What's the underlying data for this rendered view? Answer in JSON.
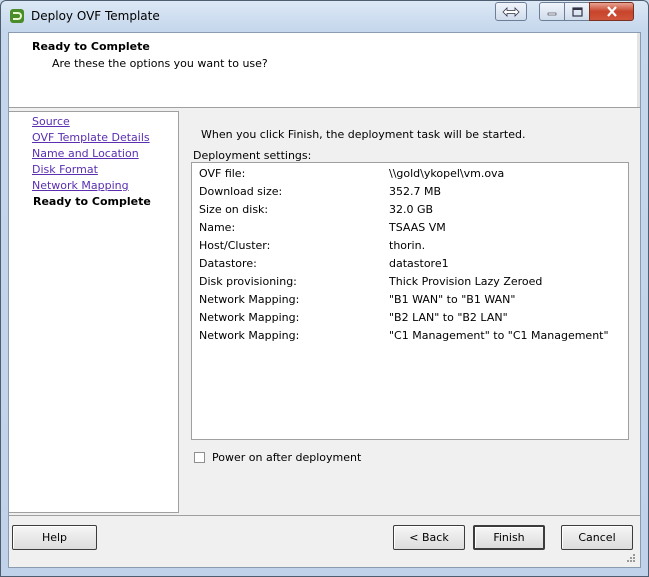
{
  "window": {
    "title": "Deploy OVF Template"
  },
  "header": {
    "title": "Ready to Complete",
    "subtitle": "Are these the options you want to use?"
  },
  "nav": {
    "items": [
      {
        "label": "Source"
      },
      {
        "label": "OVF Template Details"
      },
      {
        "label": "Name and Location"
      },
      {
        "label": "Disk Format"
      },
      {
        "label": "Network Mapping"
      },
      {
        "label": "Ready to Complete"
      }
    ]
  },
  "main": {
    "intro": "When you click Finish, the deployment task will be started.",
    "settings_label": "Deployment settings:",
    "settings": [
      {
        "key": "OVF file:",
        "value": "\\\\gold\\ykopel\\vm.ova"
      },
      {
        "key": "Download size:",
        "value": "352.7 MB"
      },
      {
        "key": "Size on disk:",
        "value": "32.0 GB"
      },
      {
        "key": "Name:",
        "value": "TSAAS VM"
      },
      {
        "key": "Host/Cluster:",
        "value": "thorin."
      },
      {
        "key": "Datastore:",
        "value": "datastore1"
      },
      {
        "key": "Disk provisioning:",
        "value": "Thick Provision Lazy Zeroed"
      },
      {
        "key": "Network Mapping:",
        "value": "\"B1 WAN\" to \"B1 WAN\""
      },
      {
        "key": "Network Mapping:",
        "value": "\"B2 LAN\" to \"B2 LAN\""
      },
      {
        "key": "Network Mapping:",
        "value": "\"C1 Management\" to \"C1 Management\""
      }
    ],
    "power_on_label": "Power on after deployment"
  },
  "buttons": {
    "help": "Help",
    "back": "< Back",
    "finish": "Finish",
    "cancel": "Cancel"
  }
}
